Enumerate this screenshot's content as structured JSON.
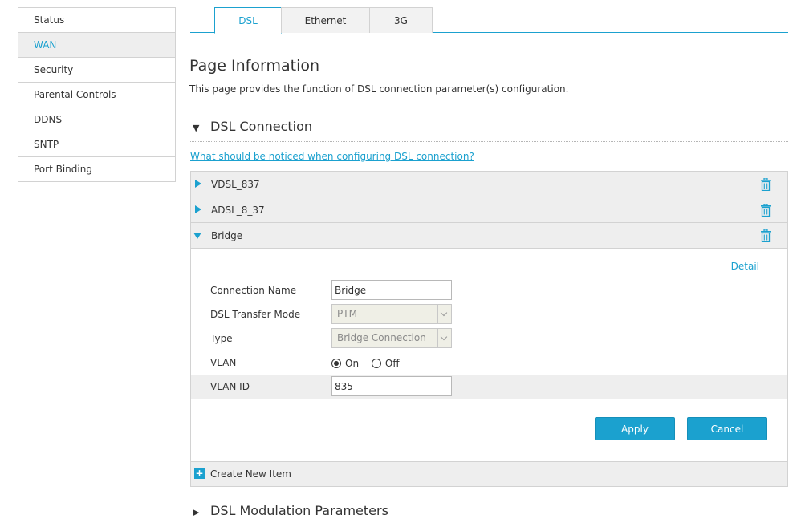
{
  "sidebar": {
    "items": [
      {
        "label": "Status"
      },
      {
        "label": "WAN"
      },
      {
        "label": "Security"
      },
      {
        "label": "Parental Controls"
      },
      {
        "label": "DDNS"
      },
      {
        "label": "SNTP"
      },
      {
        "label": "Port Binding"
      }
    ],
    "active": "WAN"
  },
  "tabs": [
    {
      "label": "DSL"
    },
    {
      "label": "Ethernet"
    },
    {
      "label": "3G"
    }
  ],
  "page": {
    "title": "Page Information",
    "description": "This page provides the function of DSL connection parameter(s) configuration."
  },
  "dsl_section": {
    "title": "DSL Connection",
    "help_link": "What should be noticed when configuring DSL connection?"
  },
  "connections": [
    {
      "name": "VDSL_837"
    },
    {
      "name": "ADSL_8_37"
    },
    {
      "name": "Bridge"
    }
  ],
  "detail": {
    "detail_link": "Detail",
    "connection_name_label": "Connection Name",
    "connection_name_value": "Bridge",
    "transfer_mode_label": "DSL Transfer Mode",
    "transfer_mode_value": "PTM",
    "type_label": "Type",
    "type_value": "Bridge Connection",
    "vlan_label": "VLAN",
    "vlan_on_label": "On",
    "vlan_off_label": "Off",
    "vlan_selected": "On",
    "vlan_id_label": "VLAN ID",
    "vlan_id_value": "835",
    "apply_label": "Apply",
    "cancel_label": "Cancel"
  },
  "create_item_label": "Create New Item",
  "modulation_section": {
    "title": "DSL Modulation Parameters"
  },
  "colors": {
    "accent": "#1ba1cf",
    "row_background": "#eeeeee",
    "border": "#d2d2d2"
  }
}
